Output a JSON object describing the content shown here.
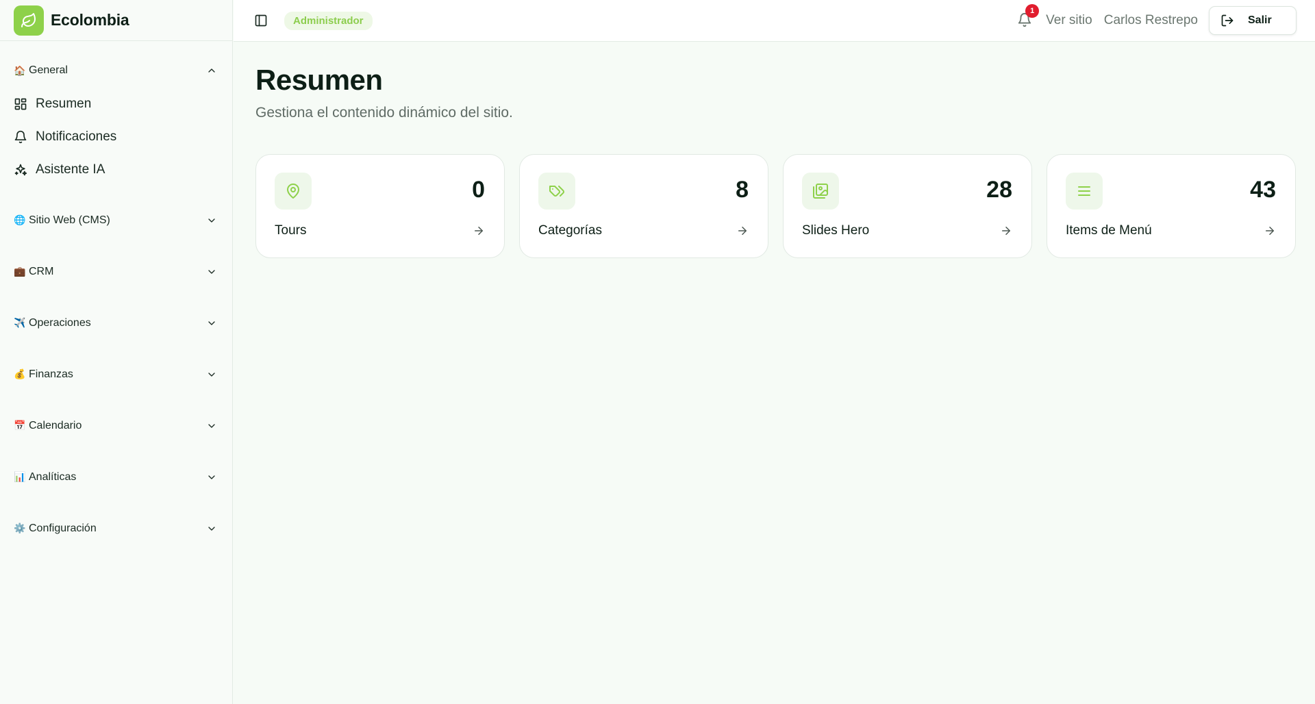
{
  "brand": {
    "name": "Ecolombia"
  },
  "topbar": {
    "role": "Administrador",
    "notifications_count": "1",
    "view_site": "Ver sitio",
    "user_name": "Carlos Restrepo",
    "logout_label": "Salir"
  },
  "sidebar": {
    "general": {
      "emoji": "🏠",
      "title": "General",
      "items": [
        {
          "label": "Resumen",
          "icon": "dashboard-icon"
        },
        {
          "label": "Notificaciones",
          "icon": "bell-icon"
        },
        {
          "label": "Asistente IA",
          "icon": "sparkles-icon"
        }
      ]
    },
    "groups": [
      {
        "emoji": "🌐",
        "title": "Sitio Web (CMS)"
      },
      {
        "emoji": "💼",
        "title": "CRM"
      },
      {
        "emoji": "✈️",
        "title": "Operaciones"
      },
      {
        "emoji": "💰",
        "title": "Finanzas"
      },
      {
        "emoji": "📅",
        "title": "Calendario"
      },
      {
        "emoji": "📊",
        "title": "Analíticas"
      },
      {
        "emoji": "⚙️",
        "title": "Configuración"
      }
    ]
  },
  "main": {
    "title": "Resumen",
    "subtitle": "Gestiona el contenido dinámico del sitio.",
    "cards": [
      {
        "value": "0",
        "label": "Tours",
        "icon": "map-pin-icon"
      },
      {
        "value": "8",
        "label": "Categorías",
        "icon": "tags-icon"
      },
      {
        "value": "28",
        "label": "Slides Hero",
        "icon": "images-icon"
      },
      {
        "value": "43",
        "label": "Items de Menú",
        "icon": "list-icon"
      }
    ]
  },
  "colors": {
    "accent": "#8ed14a",
    "badge_bg": "#eef8e6",
    "notification": "#e11d2e"
  }
}
